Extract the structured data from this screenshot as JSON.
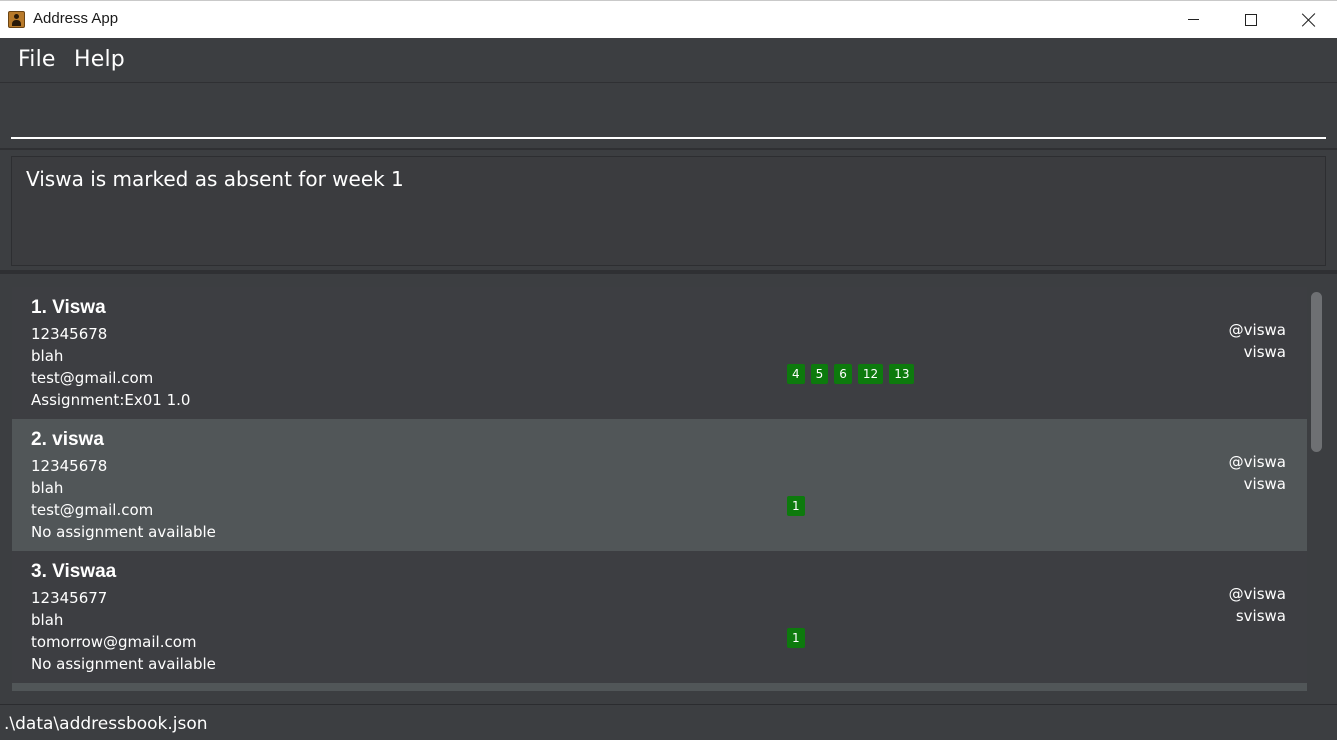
{
  "window": {
    "title": "Address App",
    "icon": "contact-book-icon"
  },
  "menu": {
    "file_label": "File",
    "help_label": "Help"
  },
  "command": {
    "value": "",
    "placeholder": ""
  },
  "result": {
    "message": "Viswa is marked as absent for week 1"
  },
  "persons": [
    {
      "name": "1. Viswa",
      "phone": "12345678",
      "address": "blah",
      "email": "test@gmail.com",
      "assignment": "Assignment:Ex01 1.0",
      "tags": [
        "4",
        "5",
        "6",
        "12",
        "13"
      ],
      "telegram": "@viswa",
      "github": "viswa"
    },
    {
      "name": "2. viswa",
      "phone": "12345678",
      "address": "blah",
      "email": "test@gmail.com",
      "assignment": "No assignment available",
      "tags": [
        "1"
      ],
      "telegram": "@viswa",
      "github": "viswa"
    },
    {
      "name": "3. Viswaa",
      "phone": "12345677",
      "address": "blah",
      "email": "tomorrow@gmail.com",
      "assignment": "No assignment available",
      "tags": [
        "1"
      ],
      "telegram": "@viswa",
      "github": "sviswa"
    }
  ],
  "status": {
    "file_path": ".\\data\\addressbook.json"
  },
  "colors": {
    "tag": "#0d7a0d",
    "selected_row": "#515658",
    "background": "#3c3e41"
  }
}
